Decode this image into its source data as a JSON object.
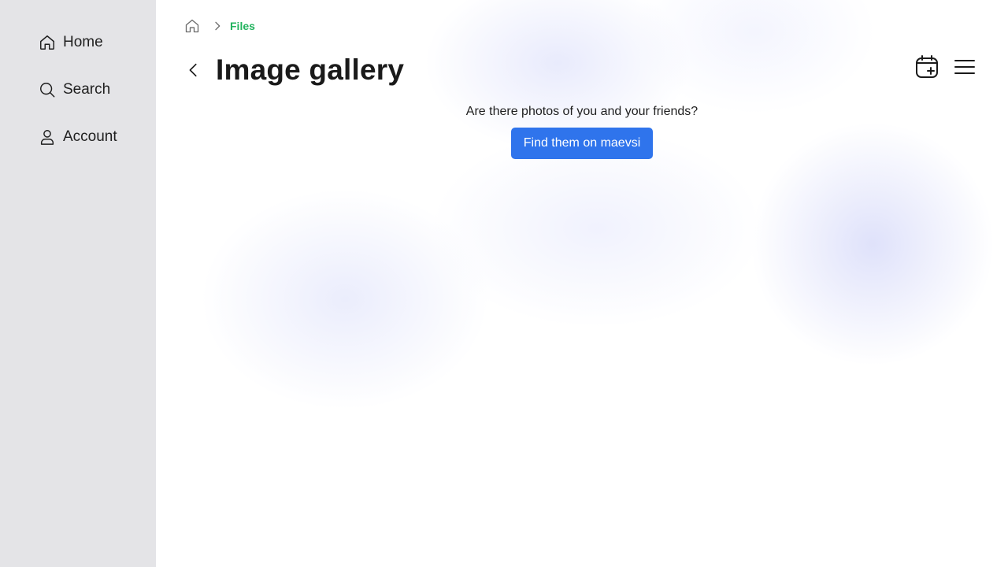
{
  "sidebar": {
    "items": [
      {
        "label": "Home",
        "icon": "home-icon"
      },
      {
        "label": "Search",
        "icon": "search-icon"
      },
      {
        "label": "Account",
        "icon": "user-icon"
      }
    ]
  },
  "breadcrumb": {
    "home_icon": "home-icon",
    "separator_icon": "chevron-right-icon",
    "current": "Files"
  },
  "header": {
    "back_icon": "chevron-left-icon",
    "title": "Image gallery",
    "actions": [
      {
        "icon": "calendar-add-icon"
      },
      {
        "icon": "menu-icon"
      }
    ]
  },
  "promo": {
    "text": "Are there photos of you and your friends?",
    "button_label": "Find them on maevsi"
  },
  "colors": {
    "sidebar_bg": "#e4e4e7",
    "accent_link": "#22b35e",
    "button_primary": "#2f74ec"
  }
}
